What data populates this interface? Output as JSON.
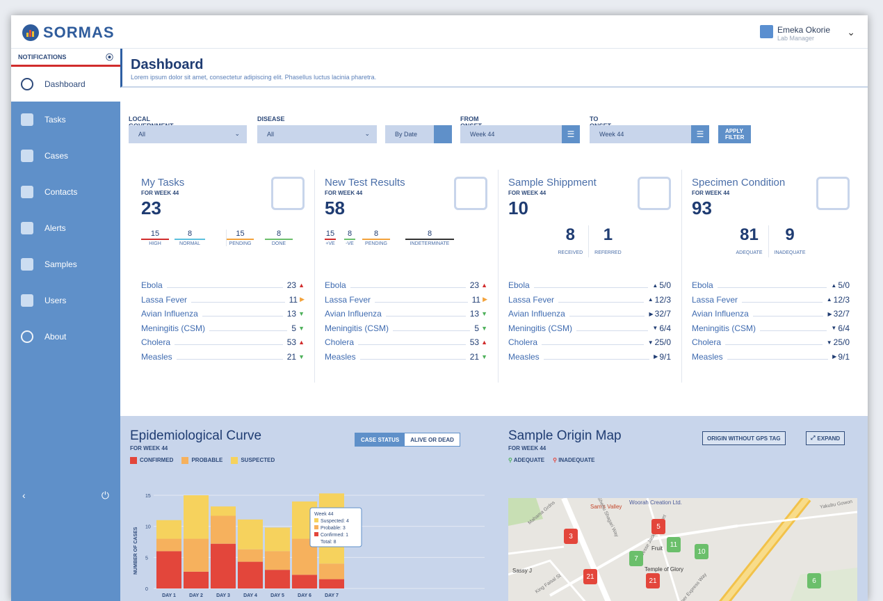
{
  "app": {
    "name": "SORMAS"
  },
  "user": {
    "name": "Emeka Okorie",
    "role": "Lab Manager"
  },
  "sidebar": {
    "notifications_label": "NOTIFICATIONS",
    "items": [
      {
        "label": "Dashboard",
        "icon": "dashboard-icon"
      },
      {
        "label": "Tasks",
        "icon": "tasks-icon"
      },
      {
        "label": "Cases",
        "icon": "cases-icon"
      },
      {
        "label": "Contacts",
        "icon": "contacts-icon"
      },
      {
        "label": "Alerts",
        "icon": "alerts-icon"
      },
      {
        "label": "Samples",
        "icon": "samples-icon"
      },
      {
        "label": "Users",
        "icon": "users-icon"
      },
      {
        "label": "About",
        "icon": "about-icon"
      }
    ]
  },
  "page": {
    "title": "Dashboard",
    "subtitle": "Lorem ipsum dolor sit amet, consectetur adipiscing elit. Phasellus luctus lacinia pharetra."
  },
  "filters": {
    "lga_label": "LOCAL GOVERNMENT AREA",
    "lga_value": "All",
    "disease_label": "DISEASE",
    "disease_value": "All",
    "by_date_label": "By Date",
    "from_label": "FROM ONSET WEEK",
    "from_value": "Week 44",
    "to_label": "TO ONSET WEEK",
    "to_value": "Week 44",
    "apply_label": "APPLY FILTER"
  },
  "cards": {
    "tasks": {
      "title": "My Tasks",
      "sub": "FOR WEEK 44",
      "big": "23",
      "stats": [
        {
          "value": "15",
          "label": "HIGH",
          "color": "#d12c2c"
        },
        {
          "value": "8",
          "label": "NORMAL",
          "color": "#5bc0de"
        },
        {
          "value": "15",
          "label": "PENDING",
          "color": "#f3a23a"
        },
        {
          "value": "8",
          "label": "DONE",
          "color": "#6bbf6b"
        }
      ],
      "diseases": [
        {
          "name": "Ebola",
          "value": "23"
        },
        {
          "name": "Lassa Fever",
          "value": "11"
        },
        {
          "name": "Avian Influenza",
          "value": "13"
        },
        {
          "name": "Meningitis (CSM)",
          "value": "5"
        },
        {
          "name": "Cholera",
          "value": "53"
        },
        {
          "name": "Measles",
          "value": "21"
        }
      ]
    },
    "tests": {
      "title": "New Test Results",
      "sub": "FOR WEEK 44",
      "big": "58",
      "stats": [
        {
          "value": "15",
          "label": "+VE",
          "color": "#d12c2c"
        },
        {
          "value": "8",
          "label": "-VE",
          "color": "#6bbf6b"
        },
        {
          "value": "8",
          "label": "PENDING",
          "color": "#f3a23a"
        },
        {
          "value": "8",
          "label": "INDETERMINATE",
          "color": "#333333"
        }
      ],
      "diseases": [
        {
          "name": "Ebola",
          "value": "23"
        },
        {
          "name": "Lassa Fever",
          "value": "11"
        },
        {
          "name": "Avian Influenza",
          "value": "13"
        },
        {
          "name": "Meningitis (CSM)",
          "value": "5"
        },
        {
          "name": "Cholera",
          "value": "53"
        },
        {
          "name": "Measles",
          "value": "21"
        }
      ]
    },
    "shipment": {
      "title": "Sample Shippment",
      "sub": "FOR WEEK 44",
      "big": "10",
      "left_value": "8",
      "left_label": "RECEIVED",
      "right_value": "1",
      "right_label": "REFERRED",
      "diseases": [
        {
          "name": "Ebola",
          "value": "5/0"
        },
        {
          "name": "Lassa Fever",
          "value": "12/3"
        },
        {
          "name": "Avian Influenza",
          "value": "32/7"
        },
        {
          "name": "Meningitis (CSM)",
          "value": "6/4"
        },
        {
          "name": "Cholera",
          "value": "25/0"
        },
        {
          "name": "Measles",
          "value": "9/1"
        }
      ]
    },
    "specimen": {
      "title": "Specimen Condition",
      "sub": "FOR WEEK 44",
      "big": "93",
      "left_value": "81",
      "left_label": "ADEQUATE",
      "right_value": "9",
      "right_label": "INADEQUATE",
      "diseases": [
        {
          "name": "Ebola",
          "value": "5/0"
        },
        {
          "name": "Lassa Fever",
          "value": "12/3"
        },
        {
          "name": "Avian Influenza",
          "value": "32/7"
        },
        {
          "name": "Meningitis (CSM)",
          "value": "6/4"
        },
        {
          "name": "Cholera",
          "value": "25/0"
        },
        {
          "name": "Measles",
          "value": "9/1"
        }
      ]
    }
  },
  "epi": {
    "title": "Epidemiological Curve",
    "sub": "FOR WEEK 44",
    "toggle_a": "CASE STATUS",
    "toggle_b": "ALIVE OR DEAD",
    "legend": [
      "CONFIRMED",
      "PROBABLE",
      "SUSPECTED"
    ],
    "tooltip": {
      "title": "Week 44",
      "suspected": "Suspected: 4",
      "probable": "Probable: 3",
      "confirmed": "Confirmed: 1",
      "total": "Total: 8"
    }
  },
  "map": {
    "title": "Sample Origin Map",
    "sub": "FOR WEEK 44",
    "btn_origin": "ORIGIN WITHOUT GPS TAG",
    "btn_expand": "EXPAND",
    "legend_a": "ADEQUATE",
    "legend_b": "INADEQUATE",
    "labels": [
      "Sam's Valley",
      "Woorah Creation Ltd.",
      "Sassy J",
      "Temple of Glory",
      "Fruit",
      "Shehu Shagari Way",
      "King Faisal St",
      "Jesse Jackson Street",
      "Yakubu Gowon",
      "Inner Express Way",
      "Mahama Grdns"
    ]
  },
  "chart_data": {
    "type": "bar",
    "categories": [
      "DAY 1",
      "DAY 2",
      "DAY 3",
      "DAY 4",
      "DAY 5",
      "DAY 6",
      "DAY 7"
    ],
    "series": [
      {
        "name": "CONFIRMED",
        "values": [
          6,
          2.7,
          7.2,
          4.3,
          3,
          2.2,
          1.5
        ],
        "color": "#e3463b"
      },
      {
        "name": "PROBABLE",
        "values": [
          2,
          5.3,
          4.5,
          2,
          3,
          5.8,
          2.5
        ],
        "color": "#f6b15d"
      },
      {
        "name": "SUSPECTED",
        "values": [
          3,
          7,
          1.5,
          4.8,
          3.8,
          6,
          11.3
        ],
        "color": "#f6d25d"
      }
    ],
    "ylabel": "NUMBER OF CASES",
    "yticks": [
      0,
      5,
      10,
      15
    ],
    "ylim": [
      0,
      15
    ]
  }
}
